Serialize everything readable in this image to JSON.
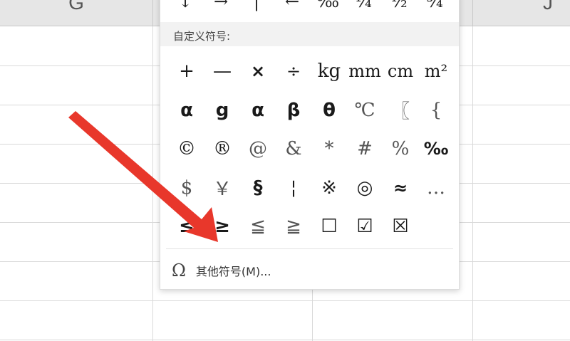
{
  "spreadsheet": {
    "columns": [
      {
        "label": "G"
      },
      {
        "label": ""
      },
      {
        "label": ""
      },
      {
        "label": "J"
      }
    ]
  },
  "popup": {
    "top_row": [
      "↓",
      "→",
      "|",
      "←",
      "‰",
      "¼",
      "½",
      "¾"
    ],
    "section_label": "自定义符号:",
    "symbols": [
      "+",
      "—",
      "×",
      "÷",
      "kg",
      "mm",
      "cm",
      "m²",
      "α",
      "g",
      "α",
      "β",
      "θ",
      "℃",
      "〖",
      "{",
      "©",
      "®",
      "@",
      "&",
      "*",
      "#",
      "%",
      "‰",
      "$",
      "￥",
      "§",
      "¦",
      "※",
      "◎",
      "≈",
      "…",
      "≤",
      "≥",
      "≦",
      "≧",
      "☐",
      "☑",
      "☒",
      ""
    ],
    "more_icon": "omega-icon",
    "more_label": "其他符号(M)..."
  },
  "annotation": {
    "arrow_color": "#e8372b"
  }
}
